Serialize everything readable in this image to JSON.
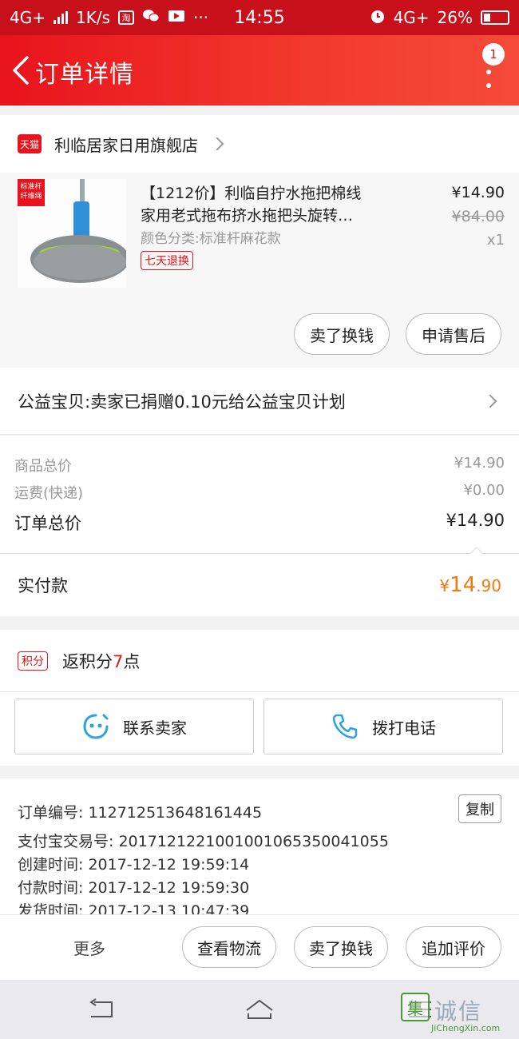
{
  "status_bar": {
    "network": "4G+",
    "speed": "1K/s",
    "app_badge": "淘",
    "time": "14:55",
    "network_right": "4G+",
    "battery": "26%"
  },
  "header": {
    "title": "订单详情",
    "notification_count": "1"
  },
  "store": {
    "badge": "天猫",
    "name": "利临居家日用旗舰店"
  },
  "product": {
    "image_tag": "标准杆 纤维绳",
    "title_line1": "【1212价】利临自拧水拖把棉线",
    "title_line2": "家用老式拖布挤水拖把头旋转…",
    "variant": "颜色分类:标准杆麻花款",
    "return_policy": "七天退换",
    "price": "¥14.90",
    "original_price": "¥84.00",
    "quantity": "x1",
    "actions": {
      "sell": "卖了换钱",
      "after_sale": "申请售后"
    }
  },
  "charity": {
    "text": "公益宝贝:卖家已捐赠0.10元给公益宝贝计划"
  },
  "summary": {
    "goods_label": "商品总价",
    "goods_value": "¥14.90",
    "shipping_label": "运费(快递)",
    "shipping_value": "¥0.00",
    "total_label": "订单总价",
    "total_value": "¥14.90"
  },
  "paid": {
    "label": "实付款",
    "currency": "¥",
    "integer": "14",
    "decimal": ".90"
  },
  "points": {
    "tag": "积分",
    "prefix": "返积分",
    "count": "7",
    "suffix": "点"
  },
  "contacts": {
    "seller": "联系卖家",
    "phone": "拨打电话"
  },
  "order_info": {
    "order_no": "订单编号: 112712513648161445",
    "copy": "复制",
    "alipay_no": "支付宝交易号: 2017121221001001065350041055",
    "created": "创建时间: 2017-12-12 19:59:14",
    "paid": "付款时间: 2017-12-12 19:59:30",
    "shipped": "发货时间: 2017-12-13 10:47:39"
  },
  "bottom_bar": {
    "more": "更多",
    "logistics": "查看物流",
    "sell": "卖了换钱",
    "review": "追加评价"
  },
  "watermark": {
    "char": "集",
    "text": "诚信",
    "sub": "JiChengXin.com"
  },
  "colors": {
    "brand_red": "#e8131c",
    "paid_orange": "#f07a12"
  }
}
